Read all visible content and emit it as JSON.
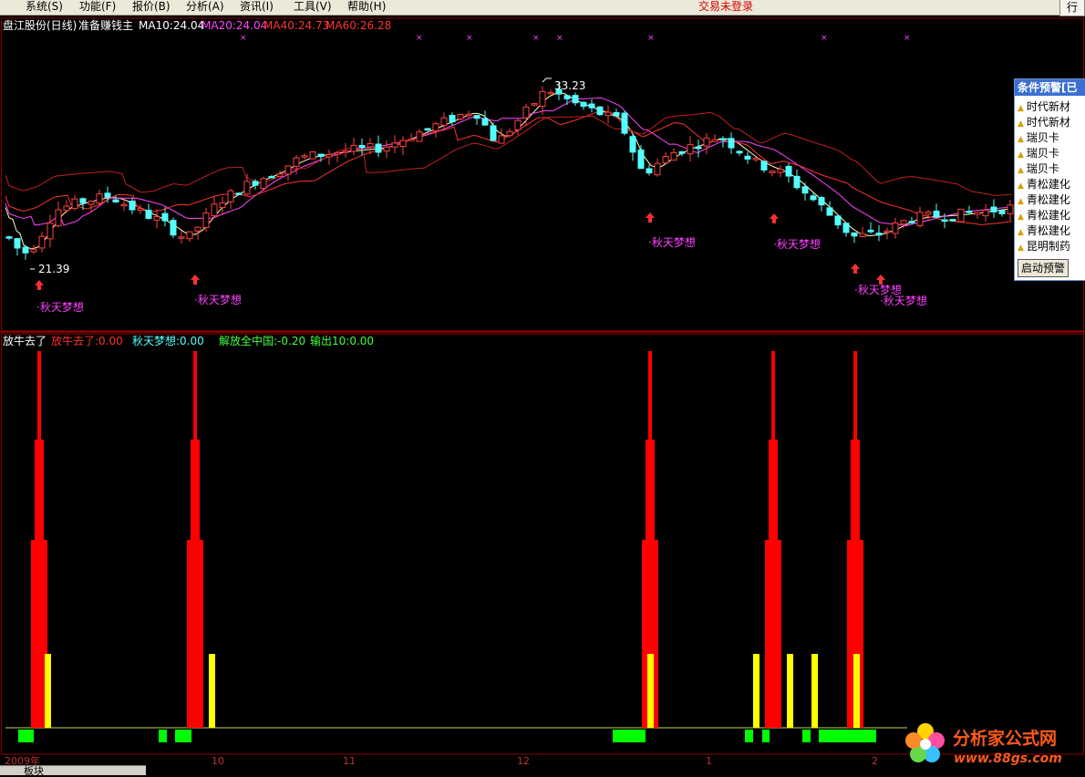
{
  "menu": {
    "items": [
      "系统(S)",
      "功能(F)",
      "报价(B)",
      "分析(A)",
      "资讯(I)",
      "工具(V)",
      "帮助(H)"
    ],
    "login_status": "交易未登录",
    "right_button": "行"
  },
  "main_chart": {
    "stock": "盘江股份(日线)",
    "indicator_name": "准备赚钱主",
    "ma10": "MA10:24.04",
    "ma20": "MA20:24.04",
    "ma40": "MA40:24.73",
    "ma60": "MA60:26.28",
    "high_label": "33.23",
    "low_label": "21.39",
    "signal_label": "秋天梦想",
    "colors": {
      "up": "#ff4040",
      "down": "#54ffff",
      "ma10": "#ffffc0",
      "ma20": "#ff44ff",
      "ma40": "#ff3333",
      "ma60": "#c02020",
      "signal": "#ff40ff"
    }
  },
  "sub_chart": {
    "name": "放牛去了",
    "label1": "放牛去了:0.00",
    "label2": "秋天梦想:0.00",
    "label3": "解放全中国:-0.20",
    "label4": "输出10:0.00"
  },
  "axis": {
    "year": "2009年",
    "months": [
      "10",
      "11",
      "12",
      "1",
      "2"
    ]
  },
  "alert_panel": {
    "title": "条件预警[已",
    "items": [
      "时代新材",
      "时代新材",
      "瑞贝卡",
      "瑞贝卡",
      "瑞贝卡",
      "青松建化",
      "青松建化",
      "青松建化",
      "青松建化",
      "昆明制药"
    ],
    "button": "启动预警"
  },
  "bottom_tab": "板块",
  "watermark": {
    "text": "分析家公式网",
    "url": "www.88gs.com"
  }
}
